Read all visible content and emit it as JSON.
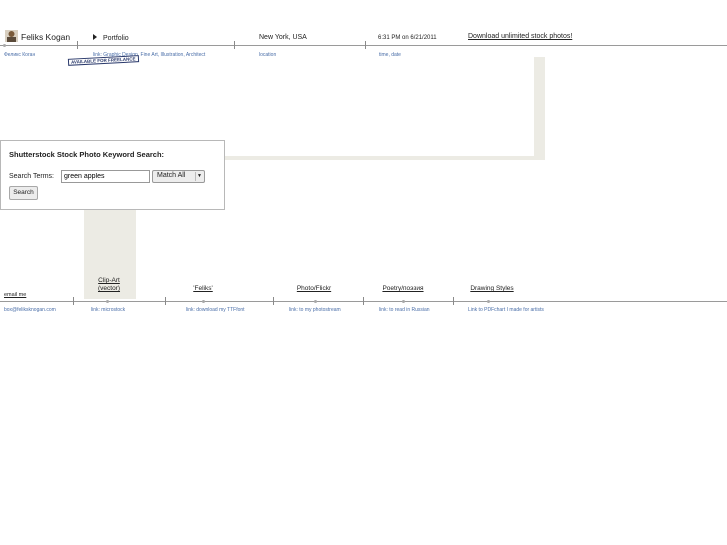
{
  "colors": {
    "accent_link": "#4a6ea8",
    "beige_block": "#ecebe4",
    "rule": "#9a9a9a"
  },
  "header": {
    "avatar_icon": "person-avatar-icon",
    "name": "Feliks Kogan",
    "name_subtitle": "Феликс Коган",
    "portfolio_arrow_icon": "triangle-right-icon",
    "portfolio": "Portfolio",
    "portfolio_sub": "link: Graphic Design, Fine Art, Illustration, Architect",
    "freelance_badge": "AVAILABLE FOR FREELANCE",
    "location": "New York, USA",
    "location_sub": "location",
    "datetime": "6:31 PM on 6/21/2011",
    "datetime_sub": "time, date",
    "download_link": "Download unlimited stock photos!"
  },
  "search_panel": {
    "title": "Shutterstock Stock Photo Keyword Search:",
    "terms_label": "Search Terms:",
    "terms_value": "green apples",
    "match_value": "Match All",
    "match_arrow_icon": "dropdown-arrow-icon",
    "search_button": "Search"
  },
  "bottom_nav": {
    "email": {
      "label": "email me",
      "sub": "box@feliksknogan.com"
    },
    "items": [
      {
        "label_line1": "Clip-Art",
        "label_line2": "(vector)",
        "sub": "link: microstock"
      },
      {
        "label_line1": "'Feliks'",
        "sub": "link: download my TTFfont"
      },
      {
        "label_line1": "Photo/Flickr",
        "sub": "link: to my photostream"
      },
      {
        "label_line1": "Poetry/поэзия",
        "sub": "link: to read in Russian"
      },
      {
        "label_line1": "Drawing Styles",
        "sub": "Link to PDFchart I made for artists"
      }
    ]
  }
}
